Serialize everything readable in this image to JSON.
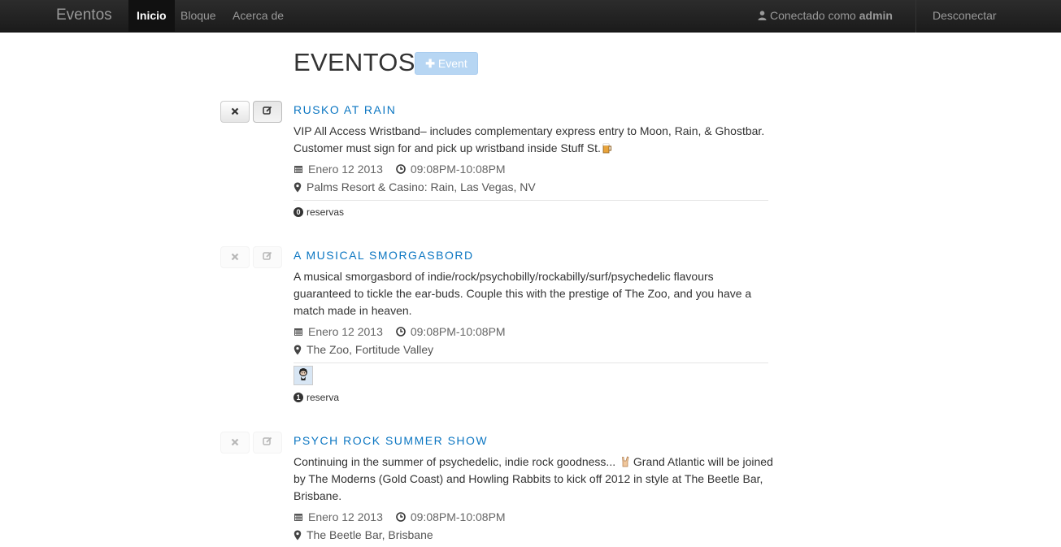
{
  "navbar": {
    "brand": "Eventos",
    "links": [
      {
        "label": "Inicio",
        "active": true
      },
      {
        "label": "Bloque",
        "active": false
      },
      {
        "label": "Acerca de",
        "active": false
      }
    ],
    "user_prefix": "Conectado como",
    "username": "admin",
    "logout_label": "Desconectar",
    "user_icon": "user-icon"
  },
  "page": {
    "title": "EVENTOS",
    "add_button_label": "Event",
    "add_button_icon": "plus-icon"
  },
  "colors": {
    "navbar": "#1b1b1b",
    "link": "#0b76c2",
    "add_button": "#b7d6f3"
  },
  "events": [
    {
      "title": "Rusko at Rain",
      "description": "VIP All Access Wristband– includes complementary express entry to Moon, Rain, & Ghostbar. Customer must sign for and pick up wristband inside Stuff St.",
      "date": "Enero 12 2013",
      "time": "09:08PM-10:08PM",
      "location": "Palms Resort & Casino: Rain, Las Vegas, NV",
      "reservation_count": "0",
      "reservation_label": "reservas",
      "actions_enabled": true,
      "emoji_icon": "beer-mug-icon"
    },
    {
      "title": "A Musical Smorgasbord",
      "description": "A musical smorgasbord of indie/rock/psychobilly/rockabilly/surf/psychedelic flavours guaranteed to tickle the ear-buds. Couple this with the prestige of The Zoo, and you have a match made in heaven.",
      "date": "Enero 12 2013",
      "time": "09:08PM-10:08PM",
      "location": "The Zoo, Fortitude Valley",
      "reservation_count": "1",
      "reservation_label": "reserva",
      "actions_enabled": false,
      "attendee_avatar": "octocat-avatar"
    },
    {
      "title": "Psych Rock Summer Show",
      "description_before": "Continuing in the summer of psychedelic, indie rock goodness...",
      "description_after": "Grand Atlantic will be joined by The Moderns (Gold Coast) and Howling Rabbits to kick off 2012 in style at The Beetle Bar, Brisbane.",
      "date": "Enero 12 2013",
      "time": "09:08PM-10:08PM",
      "location": "The Beetle Bar, Brisbane",
      "actions_enabled": false,
      "emoji_icon": "rock-hand-icon"
    }
  ]
}
